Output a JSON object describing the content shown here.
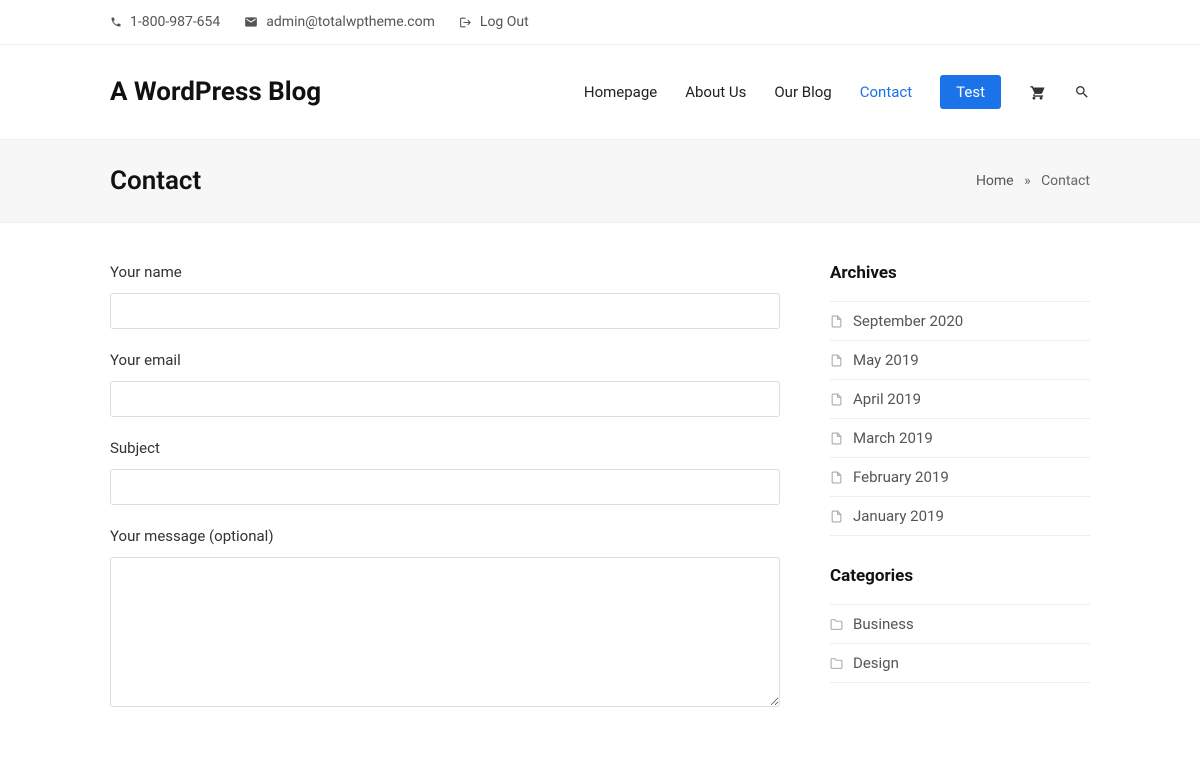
{
  "topbar": {
    "phone": "1-800-987-654",
    "email": "admin@totalwptheme.com",
    "logout": "Log Out"
  },
  "site": {
    "title": "A WordPress Blog"
  },
  "nav": {
    "items": [
      {
        "label": "Homepage",
        "active": false,
        "button": false
      },
      {
        "label": "About Us",
        "active": false,
        "button": false
      },
      {
        "label": "Our Blog",
        "active": false,
        "button": false
      },
      {
        "label": "Contact",
        "active": true,
        "button": false
      },
      {
        "label": "Test",
        "active": false,
        "button": true
      }
    ]
  },
  "page": {
    "title": "Contact",
    "breadcrumb_home": "Home",
    "breadcrumb_sep": "»",
    "breadcrumb_current": "Contact"
  },
  "form": {
    "name_label": "Your name",
    "email_label": "Your email",
    "subject_label": "Subject",
    "message_label": "Your message (optional)"
  },
  "sidebar": {
    "archives_title": "Archives",
    "archives": [
      "September 2020",
      "May 2019",
      "April 2019",
      "March 2019",
      "February 2019",
      "January 2019"
    ],
    "categories_title": "Categories",
    "categories": [
      "Business",
      "Design"
    ]
  }
}
